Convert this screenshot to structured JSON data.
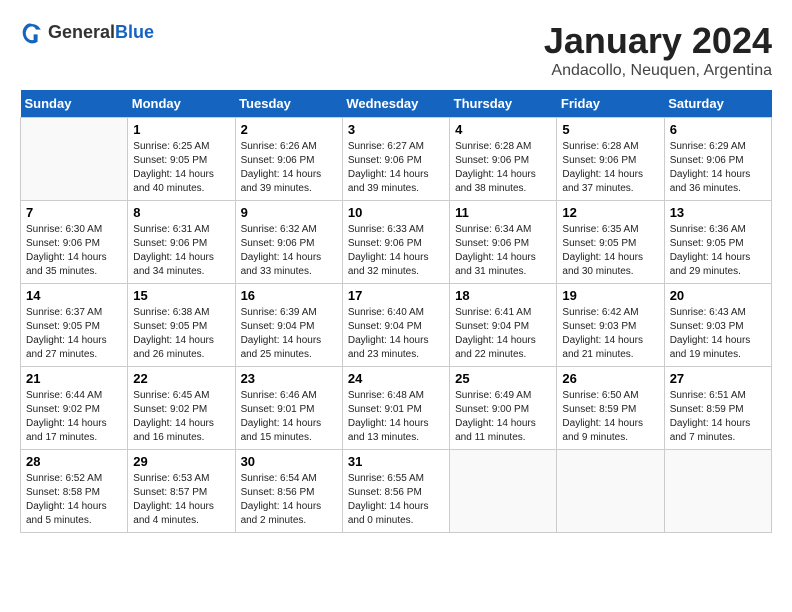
{
  "logo": {
    "general": "General",
    "blue": "Blue"
  },
  "header": {
    "title": "January 2024",
    "subtitle": "Andacollo, Neuquen, Argentina"
  },
  "weekdays": [
    "Sunday",
    "Monday",
    "Tuesday",
    "Wednesday",
    "Thursday",
    "Friday",
    "Saturday"
  ],
  "weeks": [
    [
      {
        "day": "",
        "info": ""
      },
      {
        "day": "1",
        "info": "Sunrise: 6:25 AM\nSunset: 9:05 PM\nDaylight: 14 hours\nand 40 minutes."
      },
      {
        "day": "2",
        "info": "Sunrise: 6:26 AM\nSunset: 9:06 PM\nDaylight: 14 hours\nand 39 minutes."
      },
      {
        "day": "3",
        "info": "Sunrise: 6:27 AM\nSunset: 9:06 PM\nDaylight: 14 hours\nand 39 minutes."
      },
      {
        "day": "4",
        "info": "Sunrise: 6:28 AM\nSunset: 9:06 PM\nDaylight: 14 hours\nand 38 minutes."
      },
      {
        "day": "5",
        "info": "Sunrise: 6:28 AM\nSunset: 9:06 PM\nDaylight: 14 hours\nand 37 minutes."
      },
      {
        "day": "6",
        "info": "Sunrise: 6:29 AM\nSunset: 9:06 PM\nDaylight: 14 hours\nand 36 minutes."
      }
    ],
    [
      {
        "day": "7",
        "info": "Sunrise: 6:30 AM\nSunset: 9:06 PM\nDaylight: 14 hours\nand 35 minutes."
      },
      {
        "day": "8",
        "info": "Sunrise: 6:31 AM\nSunset: 9:06 PM\nDaylight: 14 hours\nand 34 minutes."
      },
      {
        "day": "9",
        "info": "Sunrise: 6:32 AM\nSunset: 9:06 PM\nDaylight: 14 hours\nand 33 minutes."
      },
      {
        "day": "10",
        "info": "Sunrise: 6:33 AM\nSunset: 9:06 PM\nDaylight: 14 hours\nand 32 minutes."
      },
      {
        "day": "11",
        "info": "Sunrise: 6:34 AM\nSunset: 9:06 PM\nDaylight: 14 hours\nand 31 minutes."
      },
      {
        "day": "12",
        "info": "Sunrise: 6:35 AM\nSunset: 9:05 PM\nDaylight: 14 hours\nand 30 minutes."
      },
      {
        "day": "13",
        "info": "Sunrise: 6:36 AM\nSunset: 9:05 PM\nDaylight: 14 hours\nand 29 minutes."
      }
    ],
    [
      {
        "day": "14",
        "info": "Sunrise: 6:37 AM\nSunset: 9:05 PM\nDaylight: 14 hours\nand 27 minutes."
      },
      {
        "day": "15",
        "info": "Sunrise: 6:38 AM\nSunset: 9:05 PM\nDaylight: 14 hours\nand 26 minutes."
      },
      {
        "day": "16",
        "info": "Sunrise: 6:39 AM\nSunset: 9:04 PM\nDaylight: 14 hours\nand 25 minutes."
      },
      {
        "day": "17",
        "info": "Sunrise: 6:40 AM\nSunset: 9:04 PM\nDaylight: 14 hours\nand 23 minutes."
      },
      {
        "day": "18",
        "info": "Sunrise: 6:41 AM\nSunset: 9:04 PM\nDaylight: 14 hours\nand 22 minutes."
      },
      {
        "day": "19",
        "info": "Sunrise: 6:42 AM\nSunset: 9:03 PM\nDaylight: 14 hours\nand 21 minutes."
      },
      {
        "day": "20",
        "info": "Sunrise: 6:43 AM\nSunset: 9:03 PM\nDaylight: 14 hours\nand 19 minutes."
      }
    ],
    [
      {
        "day": "21",
        "info": "Sunrise: 6:44 AM\nSunset: 9:02 PM\nDaylight: 14 hours\nand 17 minutes."
      },
      {
        "day": "22",
        "info": "Sunrise: 6:45 AM\nSunset: 9:02 PM\nDaylight: 14 hours\nand 16 minutes."
      },
      {
        "day": "23",
        "info": "Sunrise: 6:46 AM\nSunset: 9:01 PM\nDaylight: 14 hours\nand 15 minutes."
      },
      {
        "day": "24",
        "info": "Sunrise: 6:48 AM\nSunset: 9:01 PM\nDaylight: 14 hours\nand 13 minutes."
      },
      {
        "day": "25",
        "info": "Sunrise: 6:49 AM\nSunset: 9:00 PM\nDaylight: 14 hours\nand 11 minutes."
      },
      {
        "day": "26",
        "info": "Sunrise: 6:50 AM\nSunset: 8:59 PM\nDaylight: 14 hours\nand 9 minutes."
      },
      {
        "day": "27",
        "info": "Sunrise: 6:51 AM\nSunset: 8:59 PM\nDaylight: 14 hours\nand 7 minutes."
      }
    ],
    [
      {
        "day": "28",
        "info": "Sunrise: 6:52 AM\nSunset: 8:58 PM\nDaylight: 14 hours\nand 5 minutes."
      },
      {
        "day": "29",
        "info": "Sunrise: 6:53 AM\nSunset: 8:57 PM\nDaylight: 14 hours\nand 4 minutes."
      },
      {
        "day": "30",
        "info": "Sunrise: 6:54 AM\nSunset: 8:56 PM\nDaylight: 14 hours\nand 2 minutes."
      },
      {
        "day": "31",
        "info": "Sunrise: 6:55 AM\nSunset: 8:56 PM\nDaylight: 14 hours\nand 0 minutes."
      },
      {
        "day": "",
        "info": ""
      },
      {
        "day": "",
        "info": ""
      },
      {
        "day": "",
        "info": ""
      }
    ]
  ]
}
